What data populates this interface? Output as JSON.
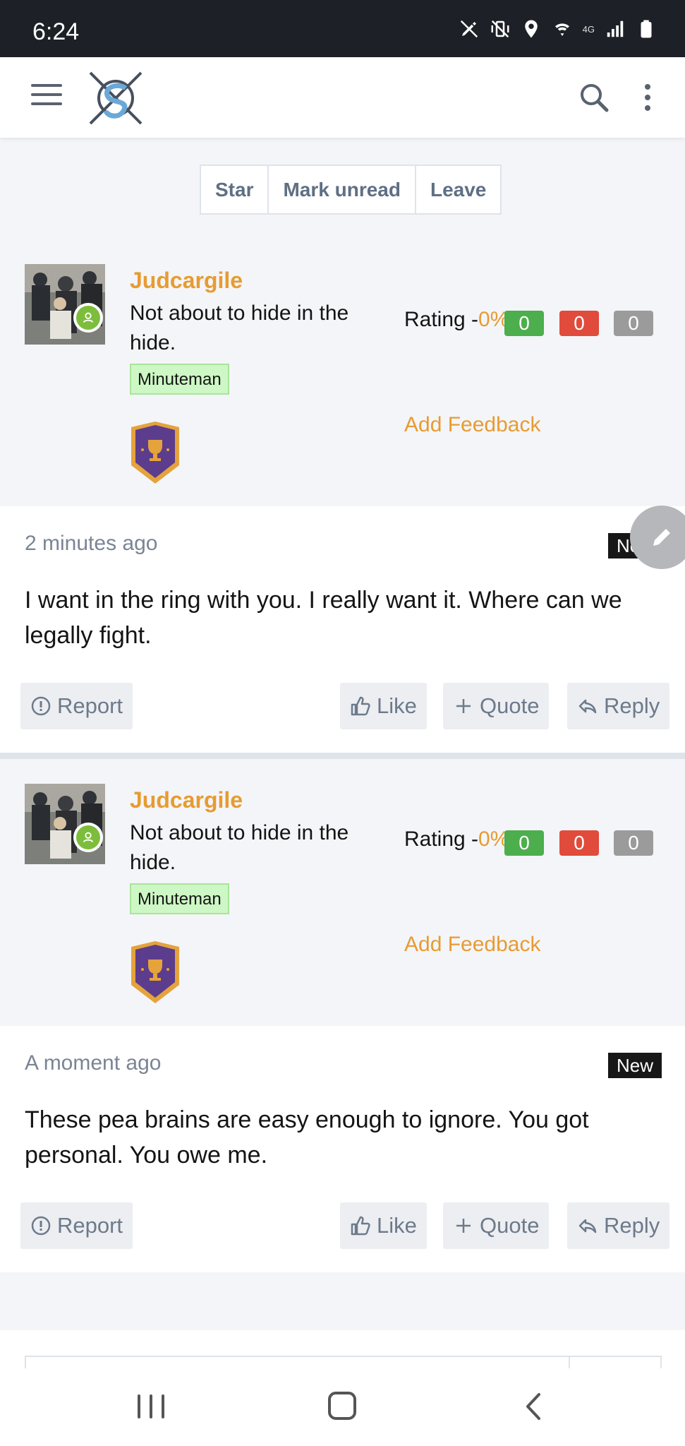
{
  "status_bar": {
    "time": "6:24",
    "network_label": "4G",
    "icons": [
      "pen-slash-icon",
      "vibrate-icon",
      "location-icon",
      "wifi-icon",
      "signal-icon",
      "battery-icon"
    ]
  },
  "header": {
    "icons": [
      "hamburger-menu-icon",
      "site-logo",
      "search-icon",
      "more-vertical-icon"
    ]
  },
  "thread_actions": {
    "star_label": "Star",
    "mark_unread_label": "Mark unread",
    "leave_label": "Leave"
  },
  "posts": [
    {
      "username": "Judcargile",
      "user_title": "Not about to hide in the hide.",
      "user_badge": "Minuteman",
      "rating_label": "Rating -",
      "rating_pct": "0%",
      "positive": "0",
      "negative": "0",
      "neutral": "0",
      "add_feedback": "Add Feedback",
      "time": "2 minutes ago",
      "new_badge": "New",
      "text": "I want in the ring with you. I really want it. Where can we legally fight.",
      "actions": {
        "report": "Report",
        "like": "Like",
        "quote": "Quote",
        "reply": "Reply"
      }
    },
    {
      "username": "Judcargile",
      "user_title": "Not about to hide in the hide.",
      "user_badge": "Minuteman",
      "rating_label": "Rating -",
      "rating_pct": "0%",
      "positive": "0",
      "negative": "0",
      "neutral": "0",
      "add_feedback": "Add Feedback",
      "time": "A moment ago",
      "new_badge": "New",
      "text": "These pea brains are easy enough to ignore. You got personal. You owe me.",
      "actions": {
        "report": "Report",
        "like": "Like",
        "quote": "Quote",
        "reply": "Reply"
      }
    }
  ],
  "colors": {
    "accent": "#e69c32",
    "online": "#7dbd3c",
    "badge_bg": "#cdf7c4",
    "positive": "#4cae4c",
    "negative": "#e04b3c",
    "neutral": "#9b9b9b"
  }
}
